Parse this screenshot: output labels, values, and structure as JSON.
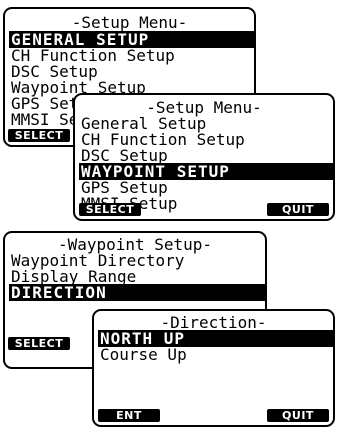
{
  "screen1": {
    "title": "-Setup Menu-",
    "items": [
      "GENERAL SETUP",
      "CH Function Setup",
      "DSC Setup",
      "Waypoint Setup",
      "GPS Setup",
      "MMSI Setup"
    ],
    "softkey_left": "SELECT"
  },
  "screen2": {
    "title": "-Setup Menu-",
    "items": [
      "General Setup",
      "CH Function Setup",
      "DSC Setup",
      "WAYPOINT SETUP",
      "GPS Setup",
      "MMSI Setup"
    ],
    "softkey_left": "SELECT",
    "softkey_right": "QUIT"
  },
  "screen3": {
    "title": "-Waypoint Setup-",
    "items": [
      "Waypoint Directory",
      "Display Range",
      "DIRECTION"
    ],
    "softkey_left": "SELECT"
  },
  "screen4": {
    "title": "-Direction-",
    "items": [
      "NORTH UP",
      "Course Up"
    ],
    "softkey_left": "ENT",
    "softkey_right": "QUIT"
  }
}
